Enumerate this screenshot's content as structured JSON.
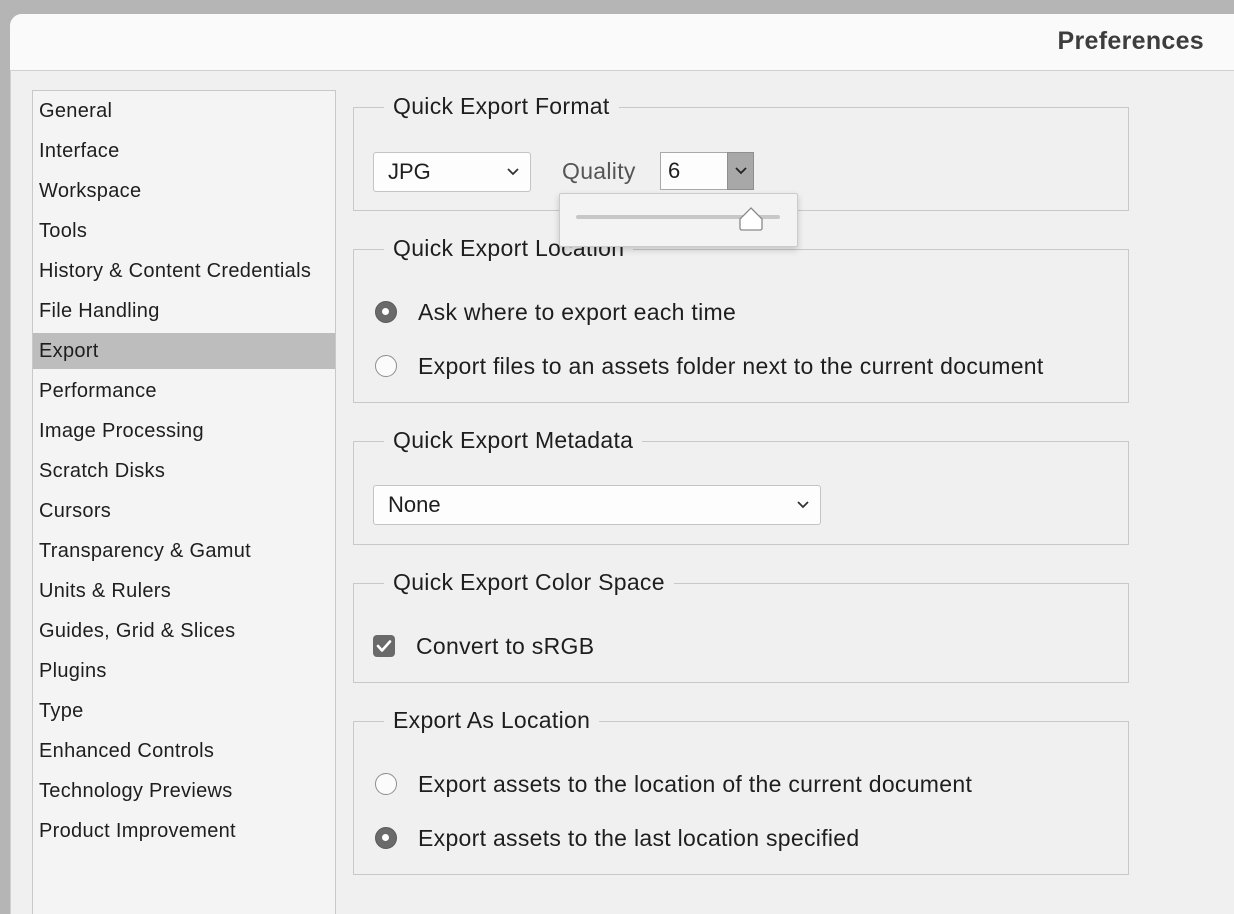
{
  "window": {
    "title": "Preferences"
  },
  "sidebar": {
    "items": [
      {
        "label": "General",
        "selected": false
      },
      {
        "label": "Interface",
        "selected": false
      },
      {
        "label": "Workspace",
        "selected": false
      },
      {
        "label": "Tools",
        "selected": false
      },
      {
        "label": "History & Content Credentials",
        "selected": false
      },
      {
        "label": "File Handling",
        "selected": false
      },
      {
        "label": "Export",
        "selected": true
      },
      {
        "label": "Performance",
        "selected": false
      },
      {
        "label": "Image Processing",
        "selected": false
      },
      {
        "label": "Scratch Disks",
        "selected": false
      },
      {
        "label": "Cursors",
        "selected": false
      },
      {
        "label": "Transparency & Gamut",
        "selected": false
      },
      {
        "label": "Units & Rulers",
        "selected": false
      },
      {
        "label": "Guides, Grid & Slices",
        "selected": false
      },
      {
        "label": "Plugins",
        "selected": false
      },
      {
        "label": "Type",
        "selected": false
      },
      {
        "label": "Enhanced Controls",
        "selected": false
      },
      {
        "label": "Technology Previews",
        "selected": false
      },
      {
        "label": "Product Improvement",
        "selected": false
      }
    ]
  },
  "quick_export_format": {
    "legend": "Quick Export Format",
    "format_value": "JPG",
    "quality_label": "Quality",
    "quality_value": "6",
    "quality_slider": {
      "value": 6,
      "min": 0,
      "max": 7
    }
  },
  "quick_export_location": {
    "legend": "Quick Export Location",
    "options": [
      {
        "label": "Ask where to export each time",
        "selected": true
      },
      {
        "label": "Export files to an assets folder next to the current document",
        "selected": false
      }
    ]
  },
  "quick_export_metadata": {
    "legend": "Quick Export Metadata",
    "value": "None"
  },
  "quick_export_color_space": {
    "legend": "Quick Export Color Space",
    "checkbox_label": "Convert to sRGB",
    "checked": true
  },
  "export_as_location": {
    "legend": "Export As Location",
    "options": [
      {
        "label": "Export assets to the location of the current document",
        "selected": false
      },
      {
        "label": "Export assets to the last location specified",
        "selected": true
      }
    ]
  },
  "colors": {
    "window_bg": "#f0f0f0",
    "selected_item_bg": "#bdbdbd",
    "control_fill": "#6a6a6a"
  }
}
